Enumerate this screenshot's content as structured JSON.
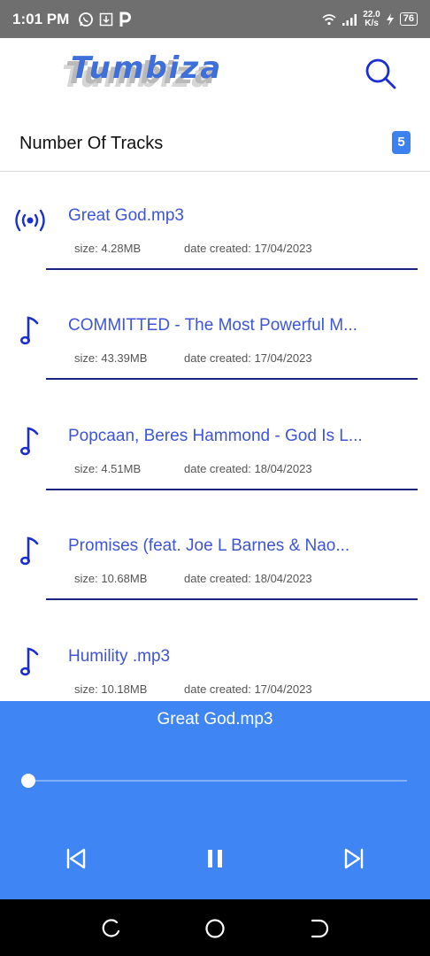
{
  "status_bar": {
    "time": "1:01 PM",
    "net_speed_value": "22.0",
    "net_speed_unit": "K/s",
    "battery": "76",
    "icons": [
      "whatsapp-icon",
      "download-icon",
      "parking-icon",
      "wifi-icon",
      "signal-icon",
      "charging-icon",
      "battery-icon"
    ]
  },
  "app": {
    "title": "Tumbiza"
  },
  "tracks_header": {
    "label": "Number Of Tracks",
    "count": "5"
  },
  "tracks": [
    {
      "title": "Great God.mp3",
      "size": "size: 4.28MB",
      "date": "date created: 17/04/2023",
      "icon": "broadcast-icon",
      "playing": true
    },
    {
      "title": "COMMITTED - The Most Powerful M...",
      "size": "size: 43.39MB",
      "date": "date created: 17/04/2023",
      "icon": "music-note-icon",
      "playing": false
    },
    {
      "title": "Popcaan, Beres Hammond - God Is L...",
      "size": "size: 4.51MB",
      "date": "date created: 18/04/2023",
      "icon": "music-note-icon",
      "playing": false
    },
    {
      "title": "Promises (feat. Joe L Barnes & Nao...",
      "size": "size: 10.68MB",
      "date": "date created: 18/04/2023",
      "icon": "music-note-icon",
      "playing": false
    },
    {
      "title": "Humility .mp3",
      "size": "size: 10.18MB",
      "date": "date created: 17/04/2023",
      "icon": "music-note-icon",
      "playing": false
    }
  ],
  "player": {
    "now_playing": "Great God.mp3",
    "progress": 0.0
  },
  "colors": {
    "accent": "#3f86f4",
    "track_title": "#3d55d6",
    "divider": "#1a237e",
    "status_bar": "#6f6f6f"
  }
}
